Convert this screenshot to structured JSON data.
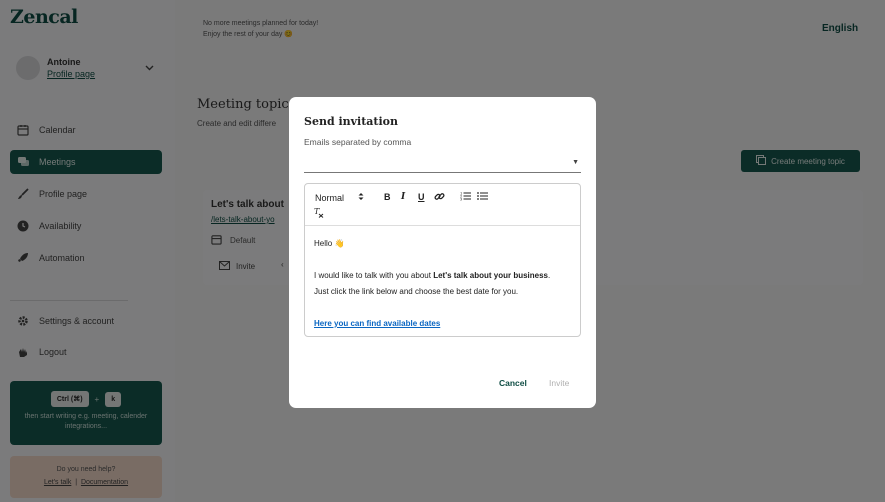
{
  "app": {
    "logo": "Zencal"
  },
  "user": {
    "name": "Antoine",
    "profile_link": "Profile page"
  },
  "nav": [
    {
      "label": "Calendar",
      "icon": "calendar-icon"
    },
    {
      "label": "Meetings",
      "icon": "chat-bubbles-icon",
      "active": true
    },
    {
      "label": "Profile page",
      "icon": "brush-icon"
    },
    {
      "label": "Availability",
      "icon": "clock-icon"
    },
    {
      "label": "Automation",
      "icon": "rocket-icon"
    },
    {
      "label": "Settings & account",
      "icon": "gear-icon"
    },
    {
      "label": "Logout",
      "icon": "hand-wave-icon"
    }
  ],
  "shortcut_card": {
    "key1": "Ctrl (⌘)",
    "plus": "+",
    "key2": "k",
    "text": "then start writing e.g. meeting, calender integrations..."
  },
  "help_card": {
    "title": "Do you need help?",
    "lets_talk": "Let's talk",
    "separator": "|",
    "documentation": "Documentation"
  },
  "banner": {
    "line1": "No more meetings planned for today!",
    "line2": "Enjoy the rest of your day 😊"
  },
  "language": "English",
  "page": {
    "title": "Meeting topics",
    "subtitle": "Create and edit differe",
    "create_button": "Create meeting topic"
  },
  "topic": {
    "title": "Let's talk about",
    "url": "/lets-talk-about-yo",
    "default_label": "Default",
    "invite_label": "Invite",
    "arrow": "‹"
  },
  "modal": {
    "title": "Send invitation",
    "emails_label": "Emails separated by comma",
    "emails_value": "",
    "toolbar": {
      "format": "Normal",
      "bold": "B",
      "italic": "I",
      "underline": "U",
      "clear": "Tx"
    },
    "content": {
      "greeting": "Hello 👋",
      "line1_prefix": "I would like to talk with you about ",
      "line1_bold": "Let's talk about your business",
      "line1_suffix": ".",
      "line2": "Just click the link below and choose the best date for you.",
      "link": "Here you can find available dates"
    },
    "cancel": "Cancel",
    "invite": "Invite"
  },
  "colors": {
    "brand": "#17594f",
    "brand_text": "#0f4d44",
    "link": "#0a66c2",
    "help_bg": "#f3d9c9"
  }
}
